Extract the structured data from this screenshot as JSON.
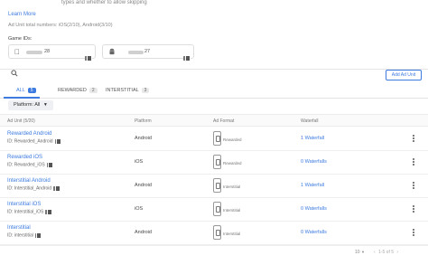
{
  "header": {
    "text_partial": "types and whether to allow skipping",
    "learn_more": "Learn More",
    "ad_unit_total": "Ad Unit total numbers: iOS(2/10), Android(3/10)",
    "game_ids_label": "Game IDs:",
    "game_ids": [
      {
        "platform": "iOS",
        "icon": "apple-icon",
        "id_visible": "28"
      },
      {
        "platform": "Android",
        "icon": "android-icon",
        "id_visible": "27"
      }
    ]
  },
  "toolbar": {
    "add_button": "Add Ad Unit",
    "search_icon": "search-icon"
  },
  "tabs": [
    {
      "label": "ALL",
      "count": "5",
      "active": true
    },
    {
      "label": "REWARDED",
      "count": "2",
      "active": false
    },
    {
      "label": "INTERSTITIAL",
      "count": "3",
      "active": false
    }
  ],
  "filter": {
    "label": "Platform: All",
    "icon": "caret-down-icon"
  },
  "table": {
    "headers": [
      "Ad Unit (5/20)",
      "Platform",
      "Ad Format",
      "Waterfall"
    ],
    "rows": [
      {
        "name": "Rewarded Android",
        "id": "ID: Rewarded_Android",
        "platform": "Android",
        "format": "Rewarded",
        "waterfall": "1 Waterfall"
      },
      {
        "name": "Rewarded iOS",
        "id": "ID: Rewarded_iOS",
        "platform": "iOS",
        "format": "Rewarded",
        "waterfall": "0 Waterfalls"
      },
      {
        "name": "Interstitial Android",
        "id": "ID: Interstitial_Android",
        "platform": "Android",
        "format": "Interstitial",
        "waterfall": "1 Waterfall"
      },
      {
        "name": "Interstitial iOS",
        "id": "ID: Interstitial_iOS",
        "platform": "iOS",
        "format": "Interstitial",
        "waterfall": "0 Waterfalls"
      },
      {
        "name": "Interstitial",
        "id": "ID: interstitial",
        "platform": "Android",
        "format": "Interstitial",
        "waterfall": "0 Waterfalls"
      }
    ]
  },
  "pagination": {
    "per_page": "10",
    "info": "1-5 of 5"
  },
  "colors": {
    "accent": "#3d7be0",
    "text": "#2d2d2d",
    "muted": "#888888"
  }
}
